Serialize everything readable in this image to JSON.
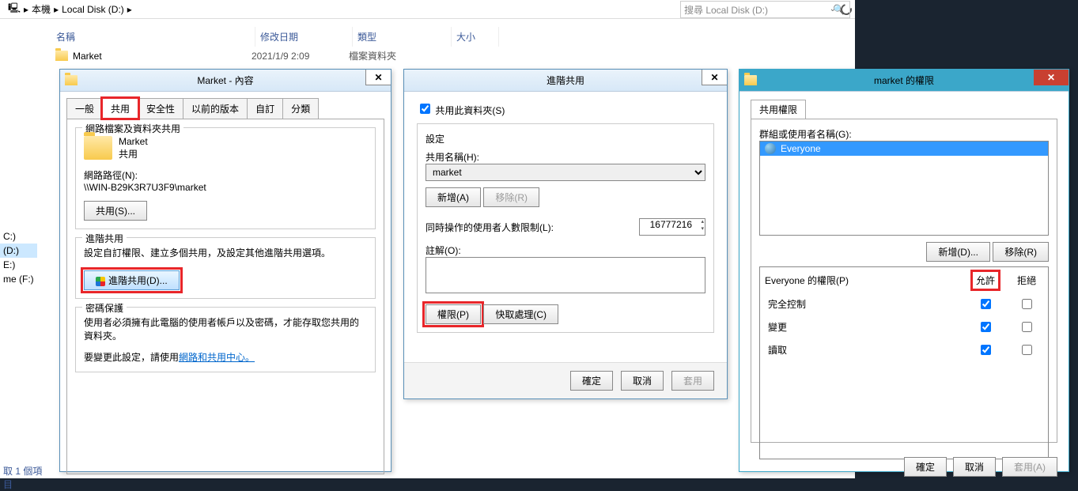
{
  "explorer": {
    "path_pc": "本機",
    "path_disk": "Local Disk (D:)",
    "search_placeholder": "搜尋 Local Disk (D:)",
    "headers": {
      "name": "名稱",
      "date": "修改日期",
      "type": "類型",
      "size": "大小"
    },
    "row": {
      "name": "Market",
      "date": "2021/1/9 2:09",
      "type": "檔案資料夾"
    },
    "tree": {
      "c": "C:)",
      "d": "(D:)",
      "e": "E:)",
      "f": "me (F:)"
    },
    "status": "取 1 個項目"
  },
  "props": {
    "title": "Market - 內容",
    "tabs": {
      "general": "一般",
      "sharing": "共用",
      "security": "安全性",
      "prev": "以前的版本",
      "custom": "自訂",
      "category": "分類"
    },
    "net_group": "網路檔案及資料夾共用",
    "folder_name": "Market",
    "shared": "共用",
    "netpath_label": "網路路徑(N):",
    "netpath": "\\\\WIN-B29K3R7U3F9\\market",
    "share_btn": "共用(S)...",
    "adv_group": "進階共用",
    "adv_desc": "設定自訂權限、建立多個共用，及設定其他進階共用選項。",
    "adv_btn": "進階共用(D)...",
    "pw_group": "密碼保護",
    "pw_desc1": "使用者必須擁有此電腦的使用者帳戶以及密碼，才能存取您共用的資料夾。",
    "pw_desc2": "要變更此設定，請使用",
    "pw_link": "網路和共用中心。"
  },
  "adv": {
    "title": "進階共用",
    "share_cb": "共用此資料夾(S)",
    "settings": "設定",
    "name_label": "共用名稱(H):",
    "name_value": "market",
    "add_btn": "新增(A)",
    "remove_btn": "移除(R)",
    "limit_label": "同時操作的使用者人數限制(L):",
    "limit_value": "16777216",
    "comment_label": "註解(O):",
    "perm_btn": "權限(P)",
    "cache_btn": "快取處理(C)",
    "ok": "確定",
    "cancel": "取消",
    "apply": "套用"
  },
  "perm": {
    "title": "market 的權限",
    "tab": "共用權限",
    "group_label": "群組或使用者名稱(G):",
    "everyone": "Everyone",
    "add_btn": "新增(D)...",
    "remove_btn": "移除(R)",
    "perm_for": "Everyone 的權限(P)",
    "allow": "允許",
    "deny": "拒絕",
    "rows": {
      "full": "完全控制",
      "change": "變更",
      "read": "讀取"
    },
    "ok": "確定",
    "cancel": "取消",
    "apply": "套用(A)"
  }
}
